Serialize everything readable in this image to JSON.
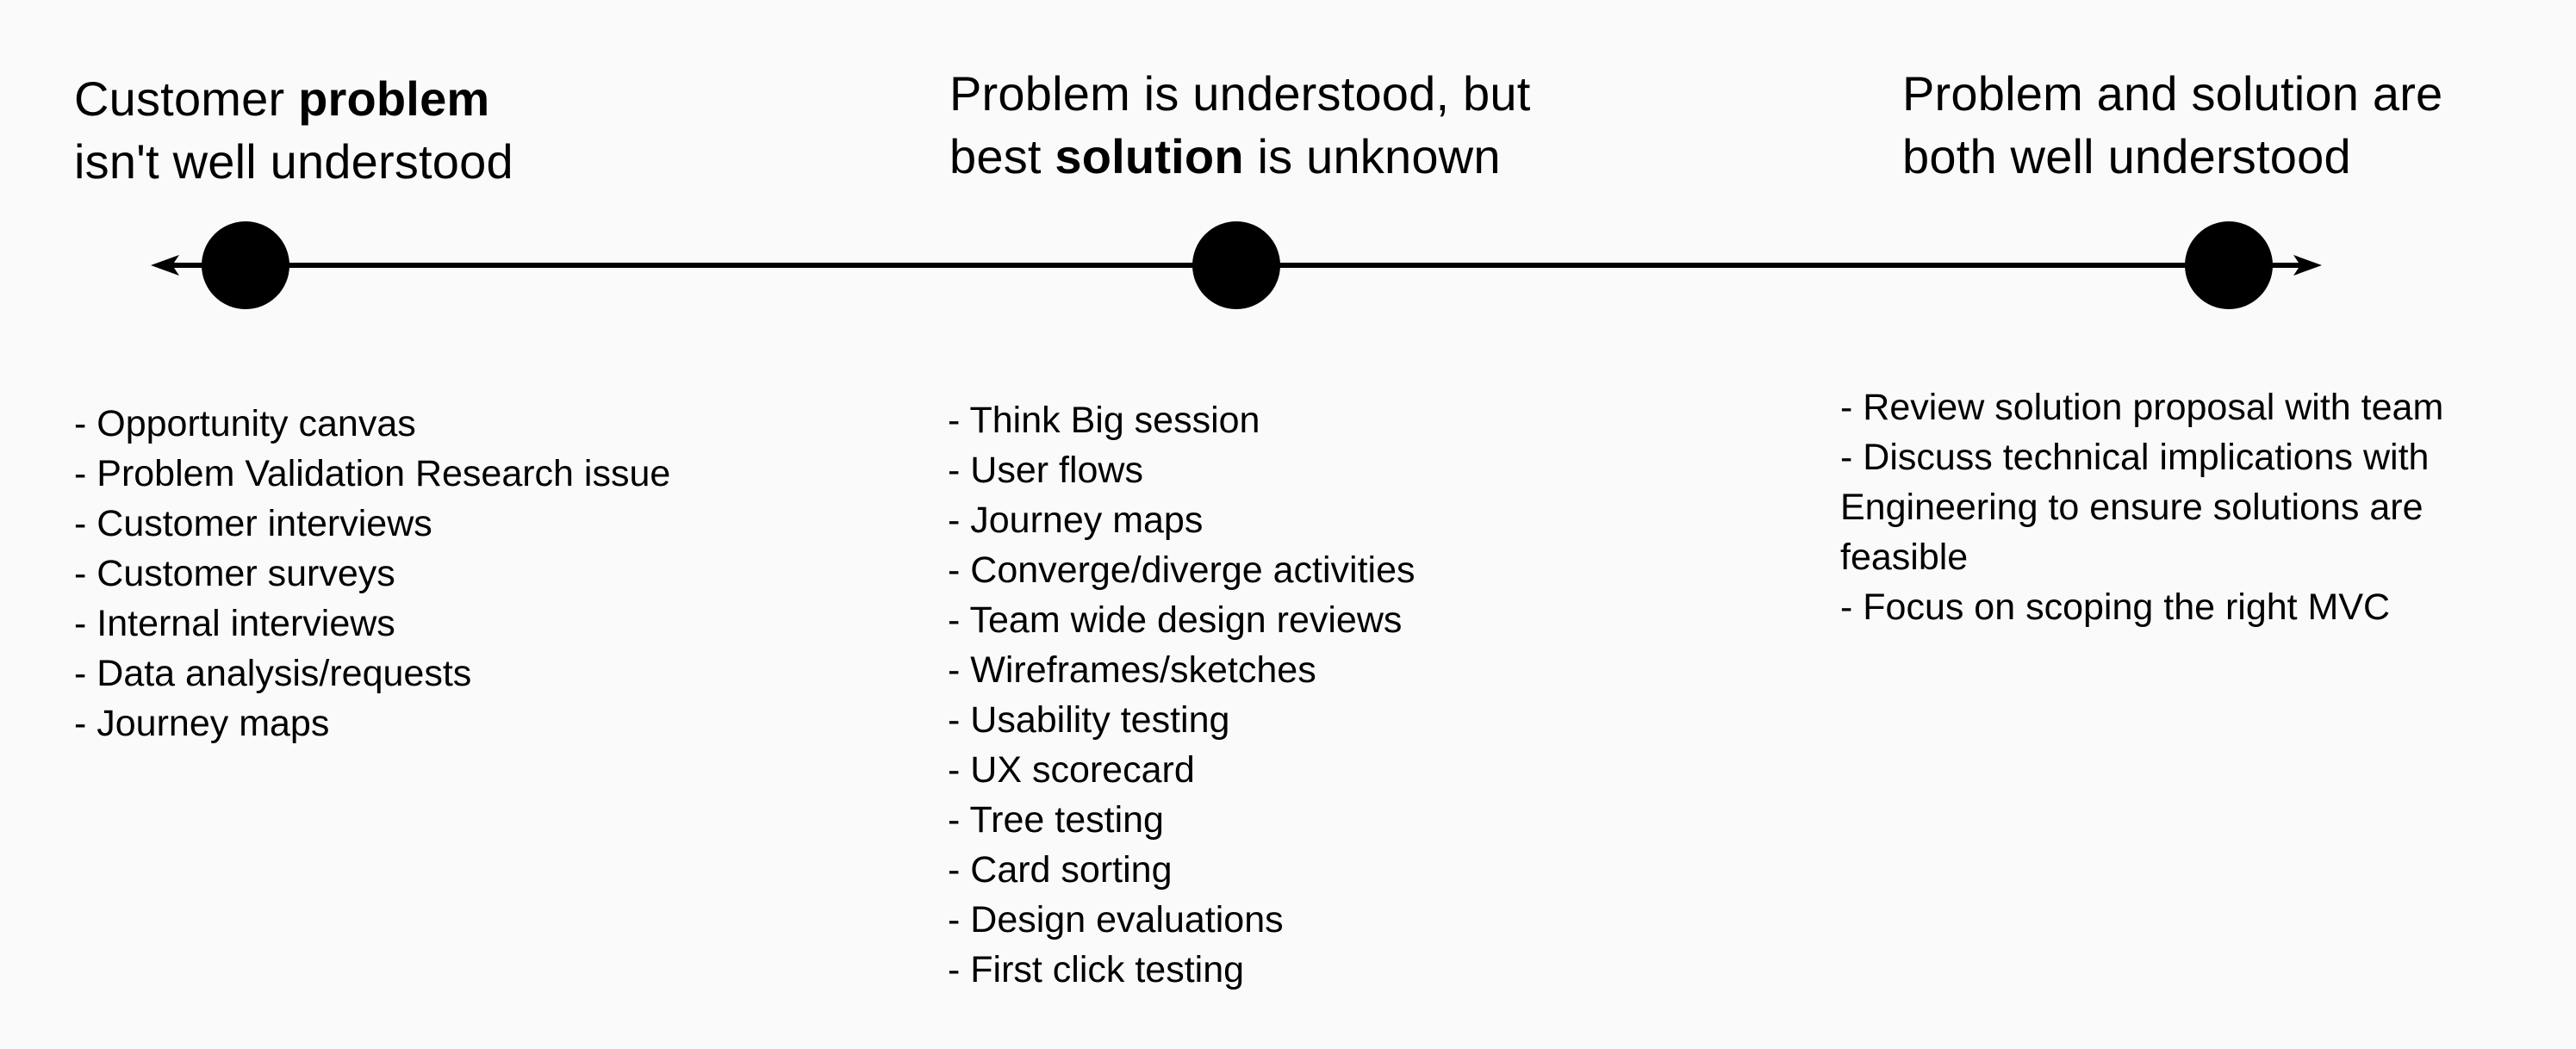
{
  "colors": {
    "background": "#fafafa",
    "ink": "#000000"
  },
  "stages": [
    {
      "heading": {
        "line1_pre": "Customer ",
        "line1_bold": "problem",
        "line1_post": "",
        "line2_pre": "isn't well understood",
        "line2_bold": "",
        "line2_post": ""
      },
      "items": [
        "- Opportunity canvas",
        "- Problem Validation Research issue",
        "- Customer interviews",
        "- Customer surveys",
        "- Internal interviews",
        "- Data analysis/requests",
        "- Journey maps"
      ]
    },
    {
      "heading": {
        "line1_pre": "Problem is understood, but",
        "line1_bold": "",
        "line1_post": "",
        "line2_pre": "best ",
        "line2_bold": "solution",
        "line2_post": " is unknown"
      },
      "items": [
        "- Think Big session",
        "- User flows",
        "- Journey maps",
        "- Converge/diverge activities",
        "- Team wide design reviews",
        "- Wireframes/sketches",
        "- Usability testing",
        "- UX scorecard",
        "- Tree testing",
        "- Card sorting",
        "- Design evaluations",
        "- First click testing"
      ]
    },
    {
      "heading": {
        "line1_pre": "Problem and solution are",
        "line1_bold": "",
        "line1_post": "",
        "line2_pre": "both well understood",
        "line2_bold": "",
        "line2_post": ""
      },
      "items": [
        "- Review solution proposal with team",
        "- Discuss technical implications with Engineering to ensure solutions are feasible",
        "- Focus on scoping the right MVC"
      ]
    }
  ],
  "timeline": {
    "direction": "bidirectional",
    "stage_count": 3,
    "left_arrow_icon": "arrow-left-icon",
    "right_arrow_icon": "arrow-right-icon"
  }
}
